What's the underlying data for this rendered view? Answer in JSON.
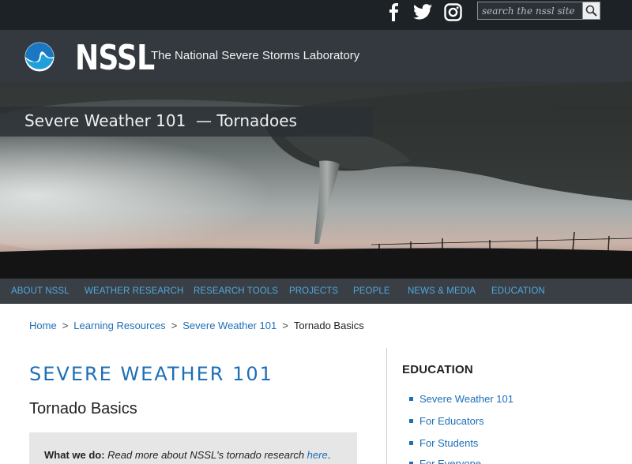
{
  "search": {
    "placeholder": "search the nssl site"
  },
  "social": [
    "facebook-icon",
    "twitter-icon",
    "instagram-icon"
  ],
  "brand": {
    "name": "NSSL",
    "tagline": "The National Severe Storms Laboratory"
  },
  "hero": {
    "caption": "Severe Weather 101  — Tornadoes"
  },
  "nav": {
    "items": [
      {
        "label": "ABOUT NSSL"
      },
      {
        "label": "WEATHER RESEARCH"
      },
      {
        "label": "RESEARCH TOOLS"
      },
      {
        "label": "PROJECTS"
      },
      {
        "label": "PEOPLE"
      },
      {
        "label": "NEWS & MEDIA"
      },
      {
        "label": "EDUCATION"
      }
    ]
  },
  "breadcrumb": {
    "items": [
      "Home",
      "Learning Resources",
      "Severe Weather 101"
    ],
    "separator": ">",
    "current": "Tornado Basics"
  },
  "content": {
    "section_heading": "SEVERE WEATHER 101",
    "title": "Tornado Basics",
    "callout": {
      "label": "What we do:",
      "text": " Read more about NSSL's tornado research ",
      "link": "here",
      "end": "."
    }
  },
  "sidebar": {
    "heading": "EDUCATION",
    "items": [
      {
        "label": "Severe Weather 101"
      },
      {
        "label": "For Educators"
      },
      {
        "label": "For Students"
      },
      {
        "label": "For Everyone"
      }
    ]
  },
  "colors": {
    "link": "#1d6fb7",
    "nav_link": "#4fa9df",
    "top_bar": "#1d2227",
    "brand_bar": "#33393f"
  }
}
